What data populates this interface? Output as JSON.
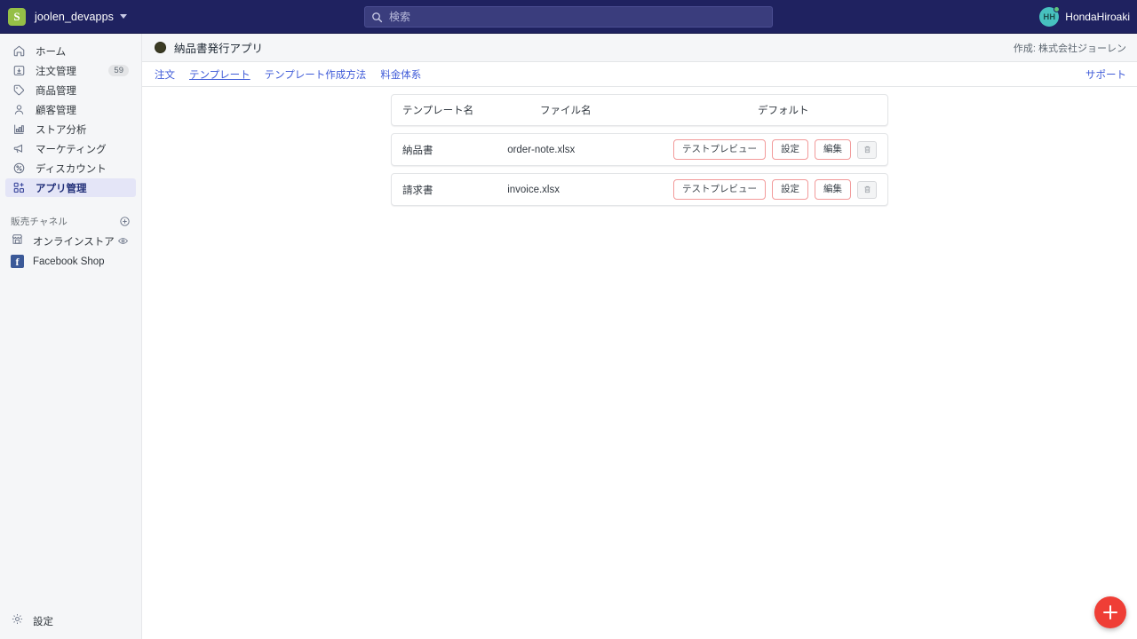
{
  "topbar": {
    "shop_name": "joolen_devapps",
    "shop_logo_letter": "S",
    "search_placeholder": "検索",
    "search_value": "",
    "search_icon": "search-icon",
    "user_name": "HondaHiroaki",
    "user_initials": "HH"
  },
  "sidebar": {
    "items": [
      {
        "label": "ホーム",
        "icon": "home-icon",
        "badge": "",
        "active": false
      },
      {
        "label": "注文管理",
        "icon": "orders-icon",
        "badge": "59",
        "active": false
      },
      {
        "label": "商品管理",
        "icon": "tag-icon",
        "badge": "",
        "active": false
      },
      {
        "label": "顧客管理",
        "icon": "person-icon",
        "badge": "",
        "active": false
      },
      {
        "label": "ストア分析",
        "icon": "bar-chart-icon",
        "badge": "",
        "active": false
      },
      {
        "label": "マーケティング",
        "icon": "megaphone-icon",
        "badge": "",
        "active": false
      },
      {
        "label": "ディスカウント",
        "icon": "discount-icon",
        "badge": "",
        "active": false
      },
      {
        "label": "アプリ管理",
        "icon": "apps-grid-icon",
        "badge": "",
        "active": true
      }
    ],
    "sales_channel": {
      "title": "販売チャネル",
      "add_icon": "plus-circle-icon",
      "channels": [
        {
          "label": "オンラインストア",
          "icon": "storefront-icon",
          "trailing_icon": "eye-icon"
        },
        {
          "label": "Facebook Shop",
          "icon": "facebook-icon",
          "trailing_icon": ""
        }
      ]
    },
    "settings": {
      "label": "設定",
      "icon": "gear-icon"
    }
  },
  "app": {
    "icon": "app-circle-icon",
    "title": "納品書発行アプリ",
    "author": "作成: 株式会社ジョーレン",
    "tabs": [
      {
        "label": "注文",
        "active": false
      },
      {
        "label": "テンプレート",
        "active": true
      },
      {
        "label": "テンプレート作成方法",
        "active": false
      },
      {
        "label": "料金体系",
        "active": false
      }
    ],
    "support_label": "サポート"
  },
  "table": {
    "columns": {
      "name": "テンプレート名",
      "file": "ファイル名",
      "default": "デフォルト"
    },
    "rows": [
      {
        "name": "納品書",
        "file": "order-note.xlsx",
        "default": "",
        "buttons": {
          "preview": "テストプレビュー",
          "settings": "設定",
          "edit": "編集",
          "delete_icon": "trash-icon"
        }
      },
      {
        "name": "請求書",
        "file": "invoice.xlsx",
        "default": "",
        "buttons": {
          "preview": "テストプレビュー",
          "settings": "設定",
          "edit": "編集",
          "delete_icon": "trash-icon"
        }
      }
    ]
  },
  "fab": {
    "icon": "plus-icon",
    "color": "#ef3e36"
  },
  "colors": {
    "topbar_bg": "#1f2260",
    "sidebar_bg": "#f5f6f8",
    "active_nav_bg": "#e4e5f7",
    "active_nav_text": "#202e78",
    "link_blue": "#3f5bd8",
    "button_border": "#f29a9a",
    "fab_red": "#ef3e36",
    "avatar_teal": "#47c1bf"
  }
}
